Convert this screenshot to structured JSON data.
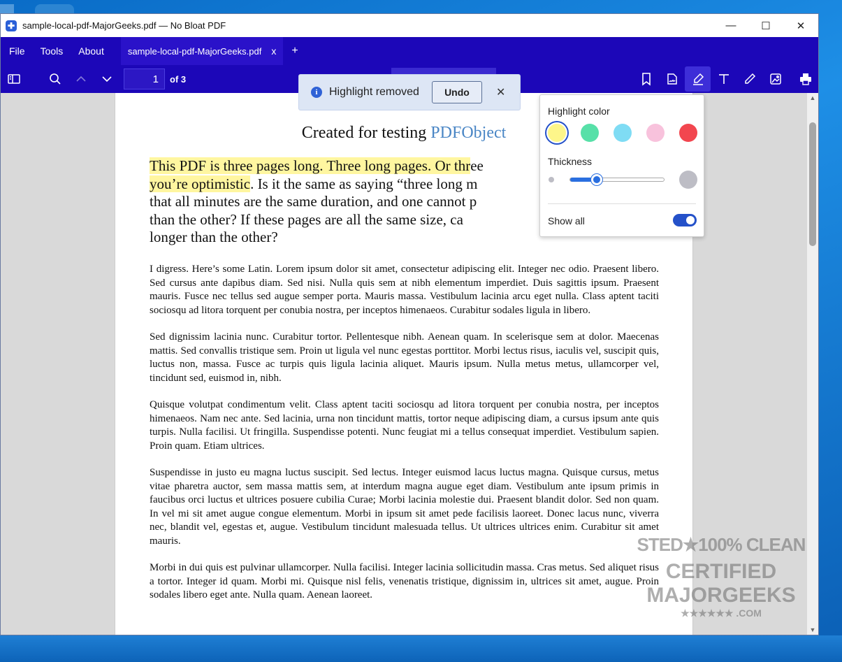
{
  "window": {
    "title": "sample-local-pdf-MajorGeeks.pdf — No Bloat PDF",
    "controls": {
      "minimize": "—",
      "maximize": "☐",
      "close": "✕"
    }
  },
  "menu": {
    "file": "File",
    "tools": "Tools",
    "about": "About"
  },
  "tab": {
    "label": "sample-local-pdf-MajorGeeks.pdf",
    "close": "x",
    "new": "+"
  },
  "toolbar": {
    "page_value": "1",
    "page_total": "of 3"
  },
  "toast": {
    "message": "Highlight removed",
    "undo": "Undo",
    "close": "✕"
  },
  "highlight_popover": {
    "color_label": "Highlight color",
    "colors": [
      "#fdf68a",
      "#57e0a8",
      "#7fdcf4",
      "#f8c2dc",
      "#f2464f"
    ],
    "selected_color": "#fdf68a",
    "thickness_label": "Thickness",
    "thickness_value": 0.28,
    "show_all_label": "Show all",
    "show_all": true
  },
  "document": {
    "title_prefix": "Created for testing ",
    "title_link": "PDFObject",
    "intro_highlighted": "This PDF is three pages long. Three long pages. Or thr",
    "intro_highlighted_2": "you’re optimistic",
    "intro_rest_line1": "ee",
    "intro_rest": ". Is it the same as saying “three long m",
    "intro_line3": "that all minutes are the same duration, and one cannot p",
    "intro_line4": "than the other? If these pages are all the same size, ca",
    "intro_line5": "longer than the other?",
    "paragraphs": [
      "I digress. Here’s some Latin. Lorem ipsum dolor sit amet, consectetur adipiscing elit. Integer nec odio. Praesent libero. Sed cursus ante dapibus diam. Sed nisi. Nulla quis sem at nibh elementum imperdiet. Duis sagittis ipsum. Praesent mauris. Fusce nec tellus sed augue semper porta. Mauris massa. Vestibulum lacinia arcu eget nulla. Class aptent taciti sociosqu ad litora torquent per conubia nostra, per inceptos himenaeos. Curabitur sodales ligula in libero.",
      "Sed dignissim lacinia nunc. Curabitur tortor. Pellentesque nibh. Aenean quam. In scelerisque sem at dolor. Maecenas mattis. Sed convallis tristique sem. Proin ut ligula vel nunc egestas porttitor. Morbi lectus risus, iaculis vel, suscipit quis, luctus non, massa. Fusce ac turpis quis ligula lacinia aliquet. Mauris ipsum. Nulla metus metus, ullamcorper vel, tincidunt sed, euismod in, nibh.",
      "Quisque volutpat condimentum velit. Class aptent taciti sociosqu ad litora torquent per conubia nostra, per inceptos himenaeos. Nam nec ante. Sed lacinia, urna non tincidunt mattis, tortor neque adipiscing diam, a cursus ipsum ante quis turpis. Nulla facilisi. Ut fringilla. Suspendisse potenti. Nunc feugiat mi a tellus consequat imperdiet. Vestibulum sapien. Proin quam. Etiam ultrices.",
      "Suspendisse in justo eu magna luctus suscipit. Sed lectus. Integer euismod lacus luctus magna. Quisque cursus, metus vitae pharetra auctor, sem massa mattis sem, at interdum magna augue eget diam. Vestibulum ante ipsum primis in faucibus orci luctus et ultrices posuere cubilia Curae; Morbi lacinia molestie dui. Praesent blandit dolor. Sed non quam. In vel mi sit amet augue congue elementum. Morbi in ipsum sit amet pede facilisis laoreet. Donec lacus nunc, viverra nec, blandit vel, egestas et, augue. Vestibulum tincidunt malesuada tellus. Ut ultrices ultrices enim. Curabitur sit amet mauris.",
      "Morbi in dui quis est pulvinar ullamcorper. Nulla facilisi. Integer lacinia sollicitudin massa. Cras metus. Sed aliquet risus a tortor. Integer id quam. Morbi mi. Quisque nisl felis, venenatis tristique, dignissim in, ultrices sit amet, augue. Proin sodales libero eget ante. Nulla quam. Aenean laoreet."
    ]
  },
  "watermark": {
    "line1": "STED★100% CLEAN",
    "line2": "CERTIFIED",
    "line3": "MAJORGEEKS",
    "line4": "★★★★★★ .COM"
  }
}
